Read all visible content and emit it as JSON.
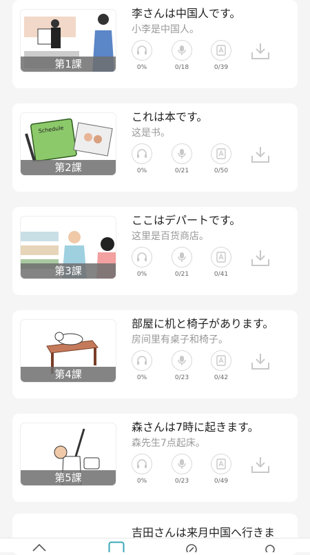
{
  "lessons": [
    {
      "number": "第1課",
      "title": "李さんは中国人です。",
      "subtitle": "小李是中国人。",
      "listen": "0%",
      "speak": "0/18",
      "words": "0/39"
    },
    {
      "number": "第2課",
      "title": "これは本です。",
      "subtitle": "这是书。",
      "listen": "0%",
      "speak": "0/21",
      "words": "0/50"
    },
    {
      "number": "第3課",
      "title": "ここはデパートです。",
      "subtitle": "这里是百货商店。",
      "listen": "0%",
      "speak": "0/21",
      "words": "0/41"
    },
    {
      "number": "第4課",
      "title": "部屋に机と椅子があります。",
      "subtitle": "房间里有桌子和椅子。",
      "listen": "0%",
      "speak": "0/23",
      "words": "0/42"
    },
    {
      "number": "第5課",
      "title": "森さんは7時に起きます。",
      "subtitle": "森先生7点起床。",
      "listen": "0%",
      "speak": "0/23",
      "words": "0/49"
    },
    {
      "title": "吉田さんは来月中国へ行きま"
    }
  ],
  "thumb_text": {
    "notebook": "Schedule"
  },
  "icons": {
    "listen": "headphones-icon",
    "speak": "microphone-icon",
    "words": "vocabulary-card-icon",
    "download": "download-icon"
  },
  "colors": {
    "icon_gray": "#c8c8c8",
    "badge": "#6e6e6e",
    "active_tab": "#3aa7b8"
  }
}
